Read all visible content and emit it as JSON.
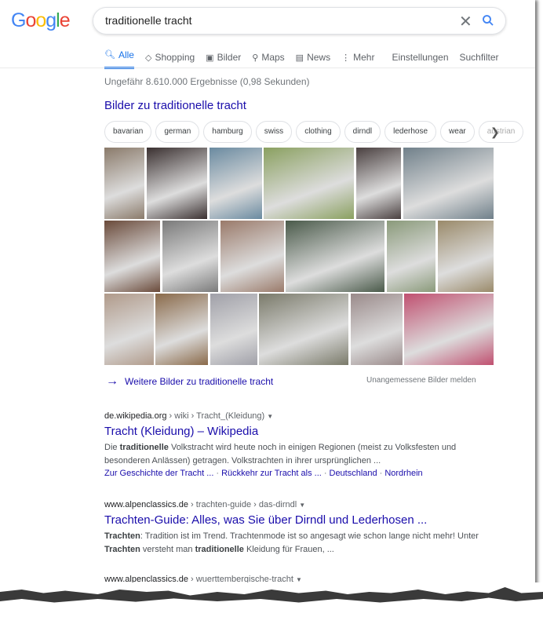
{
  "logo": "Google",
  "search": {
    "value": "traditionelle tracht"
  },
  "tabs": [
    {
      "label": "Alle",
      "icon": "search-icon"
    },
    {
      "label": "Shopping",
      "icon": "tag-icon"
    },
    {
      "label": "Bilder",
      "icon": "image-icon"
    },
    {
      "label": "Maps",
      "icon": "pin-icon"
    },
    {
      "label": "News",
      "icon": "news-icon"
    },
    {
      "label": "Mehr",
      "icon": "more-vert-icon"
    }
  ],
  "tools": [
    "Einstellungen",
    "Suchfilter"
  ],
  "stats": "Ungefähr 8.610.000 Ergebnisse (0,98 Sekunden)",
  "images": {
    "title": "Bilder zu traditionelle tracht",
    "chips": [
      "bavarian",
      "german",
      "hamburg",
      "swiss",
      "clothing",
      "dirndl",
      "lederhose",
      "wear",
      "austrian"
    ],
    "more": "Weitere Bilder zu traditionelle tracht",
    "report": "Unangemessene Bilder melden"
  },
  "results": [
    {
      "domain": "de.wikipedia.org",
      "path": " › wiki › Tracht_(Kleidung)",
      "title": "Tracht (Kleidung) – Wikipedia",
      "snippet": [
        {
          "t": "Die "
        },
        {
          "t": "traditionelle",
          "b": true
        },
        {
          "t": " Volkstracht wird heute noch in einigen Regionen (meist zu Volksfesten und besonderen Anlässen) getragen. Volkstrachten in ihrer ursprünglichen ..."
        }
      ],
      "sitelinks": [
        "Zur Geschichte der Tracht ...",
        "Rückkehr zur Tracht als ...",
        "Deutschland",
        "Nordrhein"
      ]
    },
    {
      "domain": "www.alpenclassics.de",
      "path": " › trachten-guide › das-dirndl",
      "title": "Trachten-Guide: Alles, was Sie über Dirndl und Lederhosen ...",
      "snippet": [
        {
          "t": "Trachten",
          "b": true
        },
        {
          "t": ": Tradition ist im Trend. Trachtenmode ist so angesagt wie schon lange nicht mehr! Unter "
        },
        {
          "t": "Trachten",
          "b": true
        },
        {
          "t": " versteht man "
        },
        {
          "t": "traditionelle",
          "b": true
        },
        {
          "t": " Kleidung für Frauen, ..."
        }
      ],
      "sitelinks": []
    },
    {
      "domain": "www.alpenclassics.de",
      "path": " › wuerttembergische-tracht"
    }
  ]
}
